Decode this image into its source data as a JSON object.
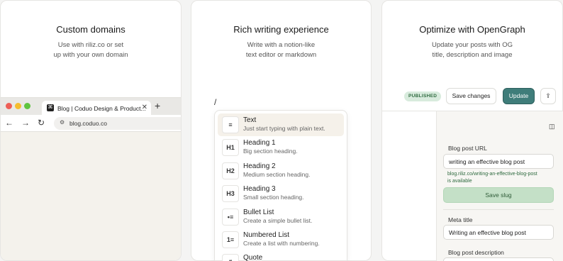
{
  "cards": {
    "domains": {
      "title": "Custom domains",
      "desc1": "Use with riliz.co or set",
      "desc2": "up with your own domain"
    },
    "writing": {
      "title": "Rich writing experience",
      "desc1": "Write with a notion-like",
      "desc2": "text editor or markdown"
    },
    "og": {
      "title": "Optimize with OpenGraph",
      "desc1": "Update your posts with OG",
      "desc2": "title, description and image"
    }
  },
  "browser": {
    "tab_title": "Blog | Coduo Design & Product...",
    "url": "blog.coduo.co"
  },
  "editor": {
    "slash": "/",
    "menu_items": [
      {
        "icon": "≡",
        "name": "Text",
        "desc": "Just start typing with plain text."
      },
      {
        "icon": "H1",
        "name": "Heading 1",
        "desc": "Big section heading."
      },
      {
        "icon": "H2",
        "name": "Heading 2",
        "desc": "Medium section heading."
      },
      {
        "icon": "H3",
        "name": "Heading 3",
        "desc": "Small section heading."
      },
      {
        "icon": "•≡",
        "name": "Bullet List",
        "desc": "Create a simple bullet list."
      },
      {
        "icon": "1≡",
        "name": "Numbered List",
        "desc": "Create a list with numbering."
      },
      {
        "icon": "❝",
        "name": "Quote",
        "desc": ""
      }
    ]
  },
  "og_panel": {
    "badge": "PUBLISHED",
    "save_changes": "Save changes",
    "update": "Update",
    "url_label": "Blog post URL",
    "url_value": "writing an effective blog post",
    "url_help1": "blog.riliz.co/writing-an-effective-blog-post",
    "url_help2": "is available",
    "save_slug": "Save slug",
    "meta_title_label": "Meta title",
    "meta_title_value": "Writing an effective blog post",
    "desc_label": "Blog post description"
  },
  "colors": {
    "accent": "#3f7d7a",
    "success_bg": "#c4e0c7",
    "badge_bg": "#d8ebdd"
  }
}
